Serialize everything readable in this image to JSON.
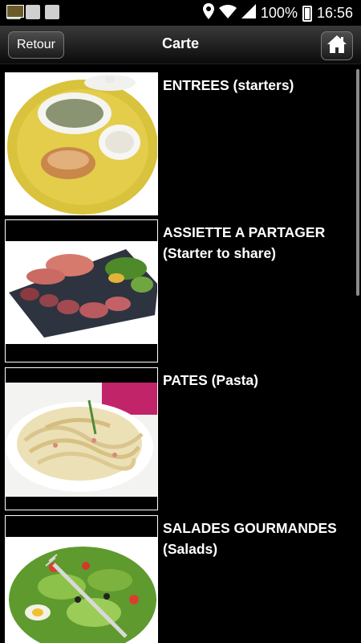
{
  "status_bar": {
    "battery_percent": "100%",
    "time": "16:56"
  },
  "nav": {
    "back_label": "Retour",
    "title": "Carte"
  },
  "menu": [
    {
      "title": "ENTREES (starters)",
      "subtitle": ""
    },
    {
      "title": "ASSIETTE A PARTAGER",
      "subtitle": "(Starter to share)"
    },
    {
      "title": "PATES (Pasta)",
      "subtitle": ""
    },
    {
      "title": "SALADES GOURMANDES",
      "subtitle": "(Salads)"
    }
  ]
}
